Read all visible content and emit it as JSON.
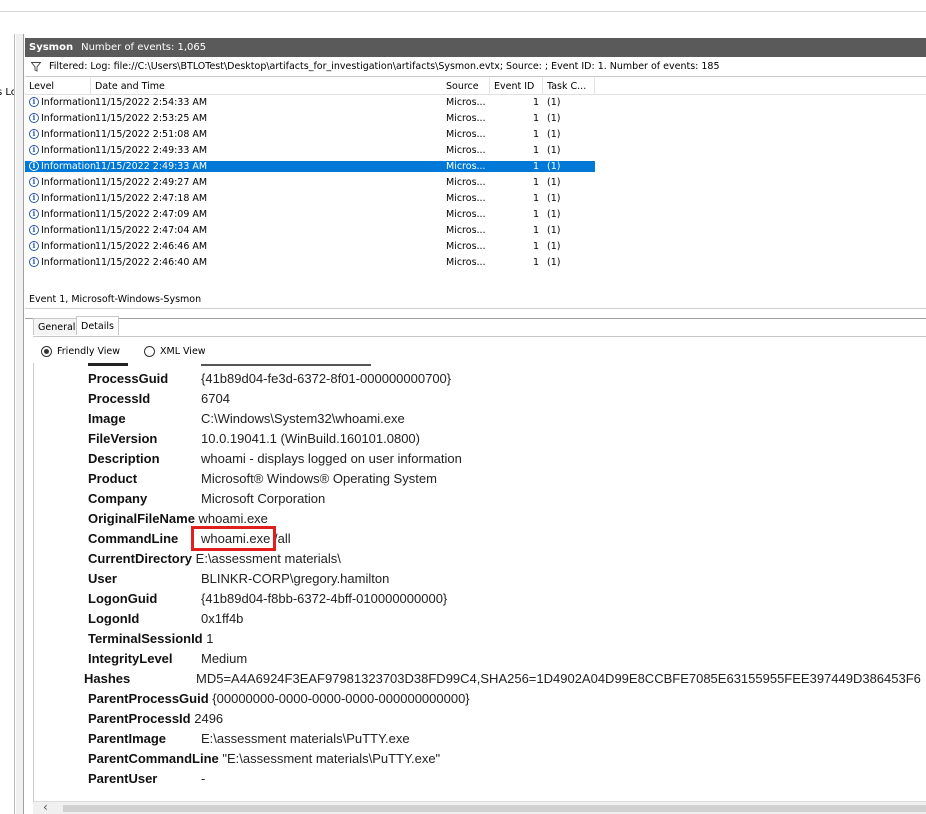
{
  "left_pane": {
    "label": "s Lo"
  },
  "title": {
    "log_name": "Sysmon",
    "event_count": "Number of events: 1,065"
  },
  "filter": {
    "text": "Filtered: Log: file://C:\\Users\\BTLOTest\\Desktop\\artifacts_for_investigation\\artifacts\\Sysmon.evtx; Source: ; Event ID: 1. Number of events: 185"
  },
  "grid": {
    "columns": [
      "Level",
      "Date and Time",
      "Source",
      "Event ID",
      "Task C..."
    ],
    "rows": [
      {
        "level": "Information",
        "datetime": "11/15/2022 2:54:33 AM",
        "source": "Micros...",
        "event_id": "1",
        "task": "(1)"
      },
      {
        "level": "Information",
        "datetime": "11/15/2022 2:53:25 AM",
        "source": "Micros...",
        "event_id": "1",
        "task": "(1)"
      },
      {
        "level": "Information",
        "datetime": "11/15/2022 2:51:08 AM",
        "source": "Micros...",
        "event_id": "1",
        "task": "(1)"
      },
      {
        "level": "Information",
        "datetime": "11/15/2022 2:49:33 AM",
        "source": "Micros...",
        "event_id": "1",
        "task": "(1)"
      },
      {
        "level": "Information",
        "datetime": "11/15/2022 2:49:33 AM",
        "source": "Micros...",
        "event_id": "1",
        "task": "(1)",
        "selected": true
      },
      {
        "level": "Information",
        "datetime": "11/15/2022 2:49:27 AM",
        "source": "Micros...",
        "event_id": "1",
        "task": "(1)"
      },
      {
        "level": "Information",
        "datetime": "11/15/2022 2:47:18 AM",
        "source": "Micros...",
        "event_id": "1",
        "task": "(1)"
      },
      {
        "level": "Information",
        "datetime": "11/15/2022 2:47:09 AM",
        "source": "Micros...",
        "event_id": "1",
        "task": "(1)"
      },
      {
        "level": "Information",
        "datetime": "11/15/2022 2:47:04 AM",
        "source": "Micros...",
        "event_id": "1",
        "task": "(1)"
      },
      {
        "level": "Information",
        "datetime": "11/15/2022 2:46:46 AM",
        "source": "Micros...",
        "event_id": "1",
        "task": "(1)"
      },
      {
        "level": "Information",
        "datetime": "11/15/2022 2:46:40 AM",
        "source": "Micros...",
        "event_id": "1",
        "task": "(1)"
      }
    ]
  },
  "detail_header": "Event 1, Microsoft-Windows-Sysmon",
  "tabs": [
    "General",
    "Details"
  ],
  "view_options": {
    "friendly": "Friendly View",
    "xml": "XML View"
  },
  "fields": {
    "ProcessGuid": {
      "k": "ProcessGuid",
      "v": "{41b89d04-fe3d-6372-8f01-000000000700}"
    },
    "ProcessId": {
      "k": "ProcessId",
      "v": "6704"
    },
    "Image": {
      "k": "Image",
      "v": "C:\\Windows\\System32\\whoami.exe"
    },
    "FileVersion": {
      "k": "FileVersion",
      "v": "10.0.19041.1 (WinBuild.160101.0800)"
    },
    "Description": {
      "k": "Description",
      "v": "whoami - displays logged on user information"
    },
    "Product": {
      "k": "Product",
      "v": "Microsoft® Windows® Operating System"
    },
    "Company": {
      "k": "Company",
      "v": "Microsoft Corporation"
    },
    "OriginalFileName": {
      "k": "OriginalFileName",
      "v": "whoami.exe"
    },
    "CommandLine": {
      "k": "CommandLine",
      "v": "whoami.exe /all"
    },
    "CurrentDirectory": {
      "k": "CurrentDirectory",
      "v": "E:\\assessment materials\\"
    },
    "User": {
      "k": "User",
      "v": "BLINKR-CORP\\gregory.hamilton"
    },
    "LogonGuid": {
      "k": "LogonGuid",
      "v": "{41b89d04-f8bb-6372-4bff-010000000000}"
    },
    "LogonId": {
      "k": "LogonId",
      "v": "0x1ff4b"
    },
    "TerminalSessionId": {
      "k": "TerminalSessionId",
      "v": "1"
    },
    "IntegrityLevel": {
      "k": "IntegrityLevel",
      "v": "Medium"
    },
    "Hashes": {
      "k": "Hashes",
      "v": "MD5=A4A6924F3EAF97981323703D38FD99C4,SHA256=1D4902A04D99E8CCBFE7085E63155955FEE397449D386453F6"
    },
    "ParentProcessGuid": {
      "k": "ParentProcessGuid",
      "v": "{00000000-0000-0000-0000-000000000000}"
    },
    "ParentProcessId": {
      "k": "ParentProcessId",
      "v": "2496"
    },
    "ParentImage": {
      "k": "ParentImage",
      "v": "E:\\assessment materials\\PuTTY.exe"
    },
    "ParentCommandLine": {
      "k": "ParentCommandLine",
      "v": "\"E:\\assessment materials\\PuTTY.exe\""
    },
    "ParentUser": {
      "k": "ParentUser",
      "v": "-"
    }
  },
  "colors": {
    "selection": "#0078d7",
    "title_bar": "#5a5a5a",
    "highlight_box": "#e21f1f"
  },
  "icons": {
    "filter": "funnel-icon",
    "info": "information-icon",
    "scroll_left": "chevron-left-icon"
  }
}
